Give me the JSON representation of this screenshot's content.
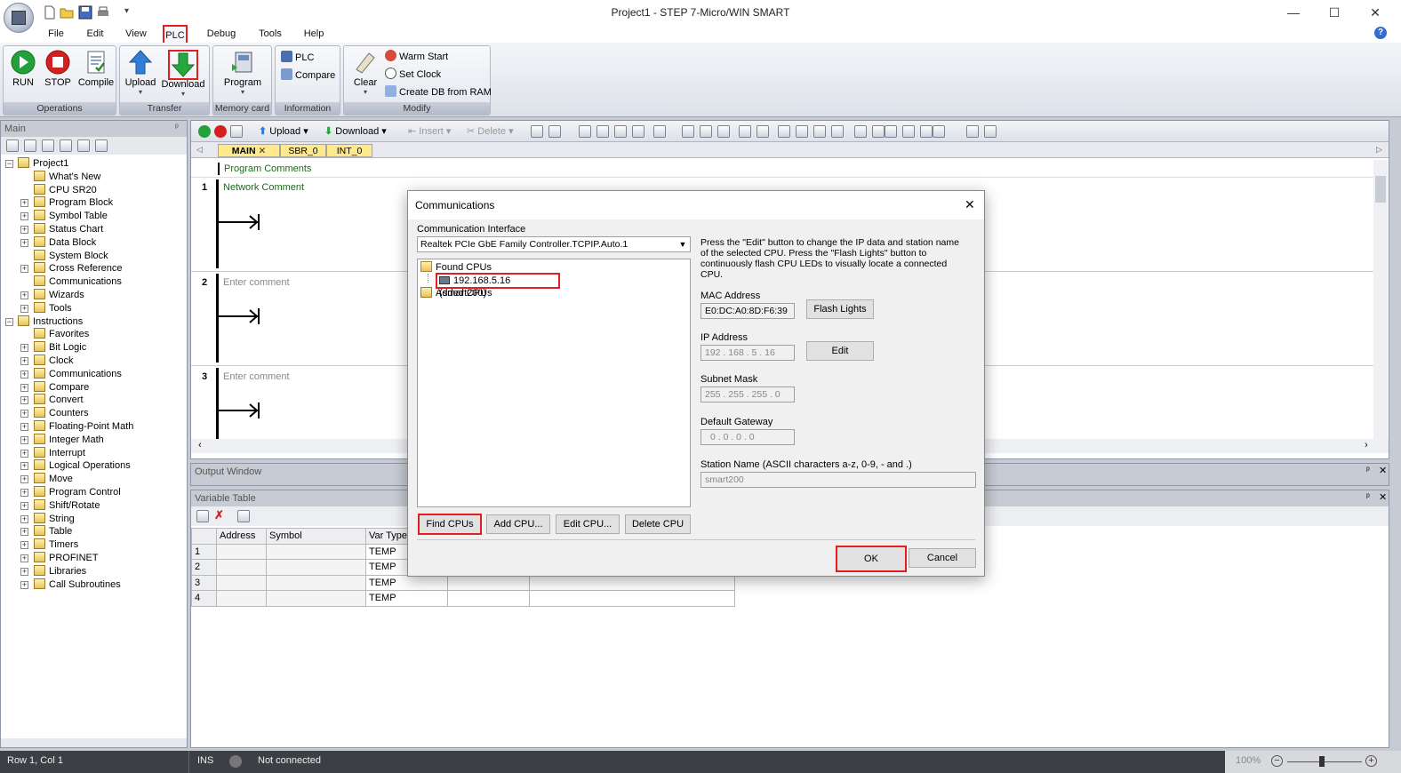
{
  "window": {
    "title": "Project1 - STEP 7-Micro/WIN SMART"
  },
  "menu": {
    "file": "File",
    "edit": "Edit",
    "view": "View",
    "plc": "PLC",
    "debug": "Debug",
    "tools": "Tools",
    "help": "Help"
  },
  "ribbon": {
    "operations": {
      "label": "Operations",
      "run": "RUN",
      "stop": "STOP",
      "compile": "Compile"
    },
    "transfer": {
      "label": "Transfer",
      "upload": "Upload",
      "download": "Download"
    },
    "memory_card": {
      "label": "Memory card",
      "program": "Program"
    },
    "information": {
      "label": "Information",
      "plc": "PLC",
      "compare": "Compare"
    },
    "modify": {
      "label": "Modify",
      "clear": "Clear",
      "warm_start": "Warm Start",
      "set_clock": "Set Clock",
      "create_db": "Create DB from RAM"
    }
  },
  "left_panel": {
    "title": "Main",
    "tree": [
      {
        "label": "Project1",
        "level": 0,
        "exp": "−"
      },
      {
        "label": "What's New",
        "level": 1
      },
      {
        "label": "CPU SR20",
        "level": 1
      },
      {
        "label": "Program Block",
        "level": 1,
        "exp": "+"
      },
      {
        "label": "Symbol Table",
        "level": 1,
        "exp": "+"
      },
      {
        "label": "Status Chart",
        "level": 1,
        "exp": "+"
      },
      {
        "label": "Data Block",
        "level": 1,
        "exp": "+"
      },
      {
        "label": "System Block",
        "level": 1
      },
      {
        "label": "Cross Reference",
        "level": 1,
        "exp": "+"
      },
      {
        "label": "Communications",
        "level": 1
      },
      {
        "label": "Wizards",
        "level": 1,
        "exp": "+"
      },
      {
        "label": "Tools",
        "level": 1,
        "exp": "+"
      },
      {
        "label": "Instructions",
        "level": 0,
        "exp": "−"
      },
      {
        "label": "Favorites",
        "level": 1
      },
      {
        "label": "Bit Logic",
        "level": 1,
        "exp": "+"
      },
      {
        "label": "Clock",
        "level": 1,
        "exp": "+"
      },
      {
        "label": "Communications",
        "level": 1,
        "exp": "+"
      },
      {
        "label": "Compare",
        "level": 1,
        "exp": "+"
      },
      {
        "label": "Convert",
        "level": 1,
        "exp": "+"
      },
      {
        "label": "Counters",
        "level": 1,
        "exp": "+"
      },
      {
        "label": "Floating-Point Math",
        "level": 1,
        "exp": "+"
      },
      {
        "label": "Integer Math",
        "level": 1,
        "exp": "+"
      },
      {
        "label": "Interrupt",
        "level": 1,
        "exp": "+"
      },
      {
        "label": "Logical Operations",
        "level": 1,
        "exp": "+"
      },
      {
        "label": "Move",
        "level": 1,
        "exp": "+"
      },
      {
        "label": "Program Control",
        "level": 1,
        "exp": "+"
      },
      {
        "label": "Shift/Rotate",
        "level": 1,
        "exp": "+"
      },
      {
        "label": "String",
        "level": 1,
        "exp": "+"
      },
      {
        "label": "Table",
        "level": 1,
        "exp": "+"
      },
      {
        "label": "Timers",
        "level": 1,
        "exp": "+"
      },
      {
        "label": "PROFINET",
        "level": 1,
        "exp": "+"
      },
      {
        "label": "Libraries",
        "level": 1,
        "exp": "+"
      },
      {
        "label": "Call Subroutines",
        "level": 1,
        "exp": "+"
      }
    ]
  },
  "editor": {
    "toolbar": {
      "upload": "Upload",
      "download": "Download",
      "insert": "Insert",
      "delete": "Delete"
    },
    "tabs": {
      "main": "MAIN",
      "sbr": "SBR_0",
      "int": "INT_0"
    },
    "program_comments": "Program Comments",
    "networks": [
      {
        "num": "1",
        "comment": "Network Comment"
      },
      {
        "num": "2",
        "comment": "Enter comment"
      },
      {
        "num": "3",
        "comment": "Enter comment"
      }
    ]
  },
  "output_window": {
    "title": "Output Window"
  },
  "variable_table": {
    "title": "Variable Table",
    "columns": [
      "Address",
      "Symbol",
      "Var Type"
    ],
    "rows": [
      {
        "n": "1",
        "type": "TEMP"
      },
      {
        "n": "2",
        "type": "TEMP"
      },
      {
        "n": "3",
        "type": "TEMP"
      },
      {
        "n": "4",
        "type": "TEMP"
      }
    ]
  },
  "statusbar": {
    "position": "Row 1, Col 1",
    "mode": "INS",
    "connection": "Not connected",
    "zoom": "100%"
  },
  "dialog": {
    "title": "Communications",
    "interface_label": "Communication  Interface",
    "interface_value": "Realtek PCIe GbE Family Controller.TCPIP.Auto.1",
    "found_cpus": "Found CPUs",
    "cpu_entry": "192.168.5.16 (smart200)",
    "added_cpus": "Added CPUs",
    "help_text": "Press the \"Edit\" button to change the IP data and station name of the selected CPU. Press the \"Flash Lights\" button to continuously flash CPU LEDs to visually locate a connected CPU.",
    "mac_label": "MAC Address",
    "mac_value": "E0:DC:A0:8D:F6:39",
    "flash_lights": "Flash Lights",
    "ip_label": "IP Address",
    "ip_value": "192 . 168 .  5  . 16",
    "edit": "Edit",
    "subnet_label": "Subnet Mask",
    "subnet_value": "255 . 255 . 255 .  0",
    "gateway_label": "Default Gateway",
    "gateway_value": "0  .  0  .  0  .  0",
    "station_label": "Station Name (ASCII characters a-z, 0-9, - and .)",
    "station_value": "smart200",
    "find_cpus": "Find CPUs",
    "add_cpu": "Add CPU...",
    "edit_cpu": "Edit CPU...",
    "delete_cpu": "Delete CPU",
    "ok": "OK",
    "cancel": "Cancel"
  },
  "colors": {
    "highlight_red": "#e02020",
    "run_green": "#22a03a",
    "stop_red": "#d42020",
    "arrow_blue": "#2f7fd8"
  }
}
